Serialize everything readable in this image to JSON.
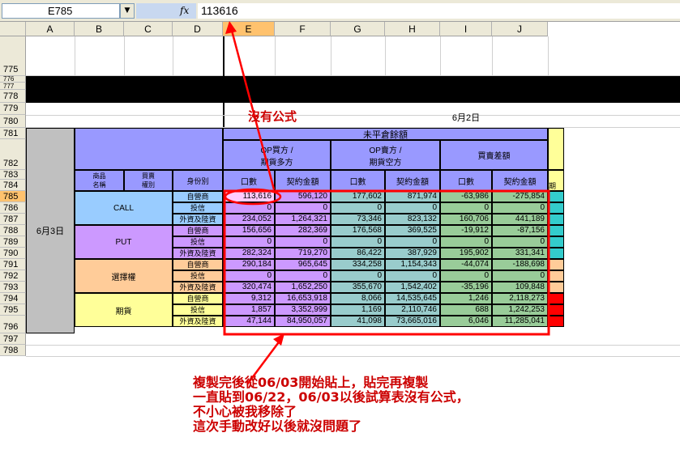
{
  "formula_bar": {
    "name_box": "E785",
    "dropdown_icon": "▼",
    "fx_label": "fx",
    "value": "113616"
  },
  "columns": [
    "A",
    "B",
    "C",
    "D",
    "E",
    "F",
    "G",
    "H",
    "I",
    "J"
  ],
  "selected_column": "E",
  "row_numbers": [
    "775",
    "776",
    "777",
    "778",
    "779",
    "780",
    "781",
    "782",
    "783",
    "784",
    "785",
    "786",
    "787",
    "788",
    "789",
    "790",
    "791",
    "792",
    "793",
    "794",
    "795",
    "796",
    "797",
    "798"
  ],
  "selected_row": "785",
  "sheet": {
    "date_top": "6月2日",
    "date_side": "6月3日",
    "header_main": "未平倉餘額",
    "header_buy": "OP買方 /\n期貨多方",
    "header_sell": "OP賣方 /\n期貨空方",
    "header_diff": "買賣差額",
    "col_product": "商品\n名稱",
    "col_type": "買賣\n權別",
    "col_identity": "身份別",
    "col_count": "口數",
    "col_amount": "契約金額",
    "k_partial": "期"
  },
  "groups": [
    {
      "name": "CALL",
      "rows": [
        {
          "identity": "自營商",
          "vals": [
            "113,616",
            "596,120",
            "177,602",
            "871,974",
            "-63,986",
            "-275,854"
          ]
        },
        {
          "identity": "投信",
          "vals": [
            "0",
            "0",
            "0",
            "0",
            "0",
            "0"
          ]
        },
        {
          "identity": "外資及陸資",
          "vals": [
            "234,052",
            "1,264,321",
            "73,346",
            "823,132",
            "160,706",
            "441,189"
          ]
        }
      ]
    },
    {
      "name": "PUT",
      "rows": [
        {
          "identity": "自營商",
          "vals": [
            "156,656",
            "282,369",
            "176,568",
            "369,525",
            "-19,912",
            "-87,156"
          ]
        },
        {
          "identity": "投信",
          "vals": [
            "0",
            "0",
            "0",
            "0",
            "0",
            "0"
          ]
        },
        {
          "identity": "外資及陸資",
          "vals": [
            "282,324",
            "719,270",
            "86,422",
            "387,929",
            "195,902",
            "331,341"
          ]
        }
      ]
    },
    {
      "name": "選擇權",
      "rows": [
        {
          "identity": "自營商",
          "vals": [
            "290,184",
            "965,645",
            "334,258",
            "1,154,343",
            "-44,074",
            "-188,698"
          ]
        },
        {
          "identity": "投信",
          "vals": [
            "0",
            "0",
            "0",
            "0",
            "0",
            "0"
          ]
        },
        {
          "identity": "外資及陸資",
          "vals": [
            "320,474",
            "1,652,250",
            "355,670",
            "1,542,402",
            "-35,196",
            "109,848"
          ]
        }
      ]
    },
    {
      "name": "期貨",
      "rows": [
        {
          "identity": "自營商",
          "vals": [
            "9,312",
            "16,653,918",
            "8,066",
            "14,535,645",
            "1,246",
            "2,118,273"
          ]
        },
        {
          "identity": "投信",
          "vals": [
            "1,857",
            "3,352,999",
            "1,169",
            "2,110,746",
            "688",
            "1,242,253"
          ]
        },
        {
          "identity": "外資及陸資",
          "vals": [
            "47,144",
            "84,950,057",
            "41,098",
            "73,665,016",
            "6,046",
            "11,285,041"
          ]
        }
      ]
    }
  ],
  "annotations": {
    "no_formula": "沒有公式",
    "note_lines": [
      "複製完後從06/03開始貼上，貼完再複製",
      "一直貼到06/22，06/03以後試算表沒有公式，",
      "不小心被我移除了",
      "這次手動改好以後就沒問題了"
    ]
  },
  "colors": {
    "call_bg": "#99ccff",
    "put_bg": "#cc99ff",
    "option_bg": "#ffcc99",
    "future_bg": "#ffff99",
    "header_bg": "#9999ff",
    "date_bg": "#c0c0c0",
    "annotation": "#ff0000"
  }
}
